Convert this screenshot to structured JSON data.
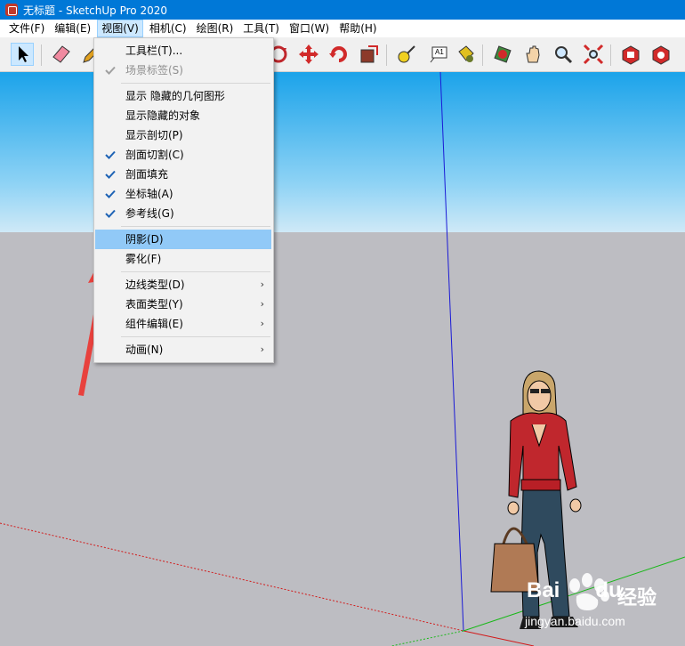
{
  "window": {
    "title": "无标题 - SketchUp Pro 2020"
  },
  "menubar": [
    {
      "label": "文件(F)"
    },
    {
      "label": "编辑(E)"
    },
    {
      "label": "视图(V)",
      "active": true
    },
    {
      "label": "相机(C)"
    },
    {
      "label": "绘图(R)"
    },
    {
      "label": "工具(T)"
    },
    {
      "label": "窗口(W)"
    },
    {
      "label": "帮助(H)"
    }
  ],
  "toolbar": {
    "tools": [
      "select-icon",
      "eraser-icon",
      "pencil-icon",
      "orbit-icon",
      "move-icon",
      "rotate-icon",
      "scale-icon",
      "tape-measure-icon",
      "text-icon",
      "paint-bucket-icon",
      "section-plane-icon",
      "pan-icon",
      "zoom-icon",
      "zoom-extents-icon",
      "3d-warehouse-icon",
      "extension-warehouse-icon"
    ],
    "text_tool_label": "A1"
  },
  "view_menu": {
    "items": [
      {
        "label": "工具栏(T)...",
        "checked": false,
        "disabled": false
      },
      {
        "label": "场景标签(S)",
        "checked": true,
        "disabled": true
      },
      {
        "separator": true
      },
      {
        "label": "显示 隐藏的几何图形",
        "checked": false
      },
      {
        "label": "显示隐藏的对象",
        "checked": false
      },
      {
        "label": "显示剖切(P)",
        "checked": false
      },
      {
        "label": "剖面切割(C)",
        "checked": true
      },
      {
        "label": "剖面填充",
        "checked": true
      },
      {
        "label": "坐标轴(A)",
        "checked": true
      },
      {
        "label": "参考线(G)",
        "checked": true
      },
      {
        "separator": true
      },
      {
        "label": "阴影(D)",
        "checked": false,
        "hover": true
      },
      {
        "label": "雾化(F)",
        "checked": false
      },
      {
        "separator": true
      },
      {
        "label": "边线类型(D)",
        "submenu": true
      },
      {
        "label": "表面类型(Y)",
        "submenu": true
      },
      {
        "label": "组件编辑(E)",
        "submenu": true
      },
      {
        "separator": true
      },
      {
        "label": "动画(N)",
        "submenu": true
      }
    ]
  },
  "colors": {
    "titlebar": "#0078d7",
    "menu_highlight": "#91c9f7",
    "check": "#1e63b5",
    "annotation_arrow": "#e8413d",
    "axis_blue": "#1a1ad6",
    "axis_red": "#d21a1a",
    "axis_green": "#1ab81a"
  },
  "watermark": {
    "brand": "Bai",
    "brand2": "du",
    "cn": "经验",
    "url": "jingyan.baidu.com"
  }
}
